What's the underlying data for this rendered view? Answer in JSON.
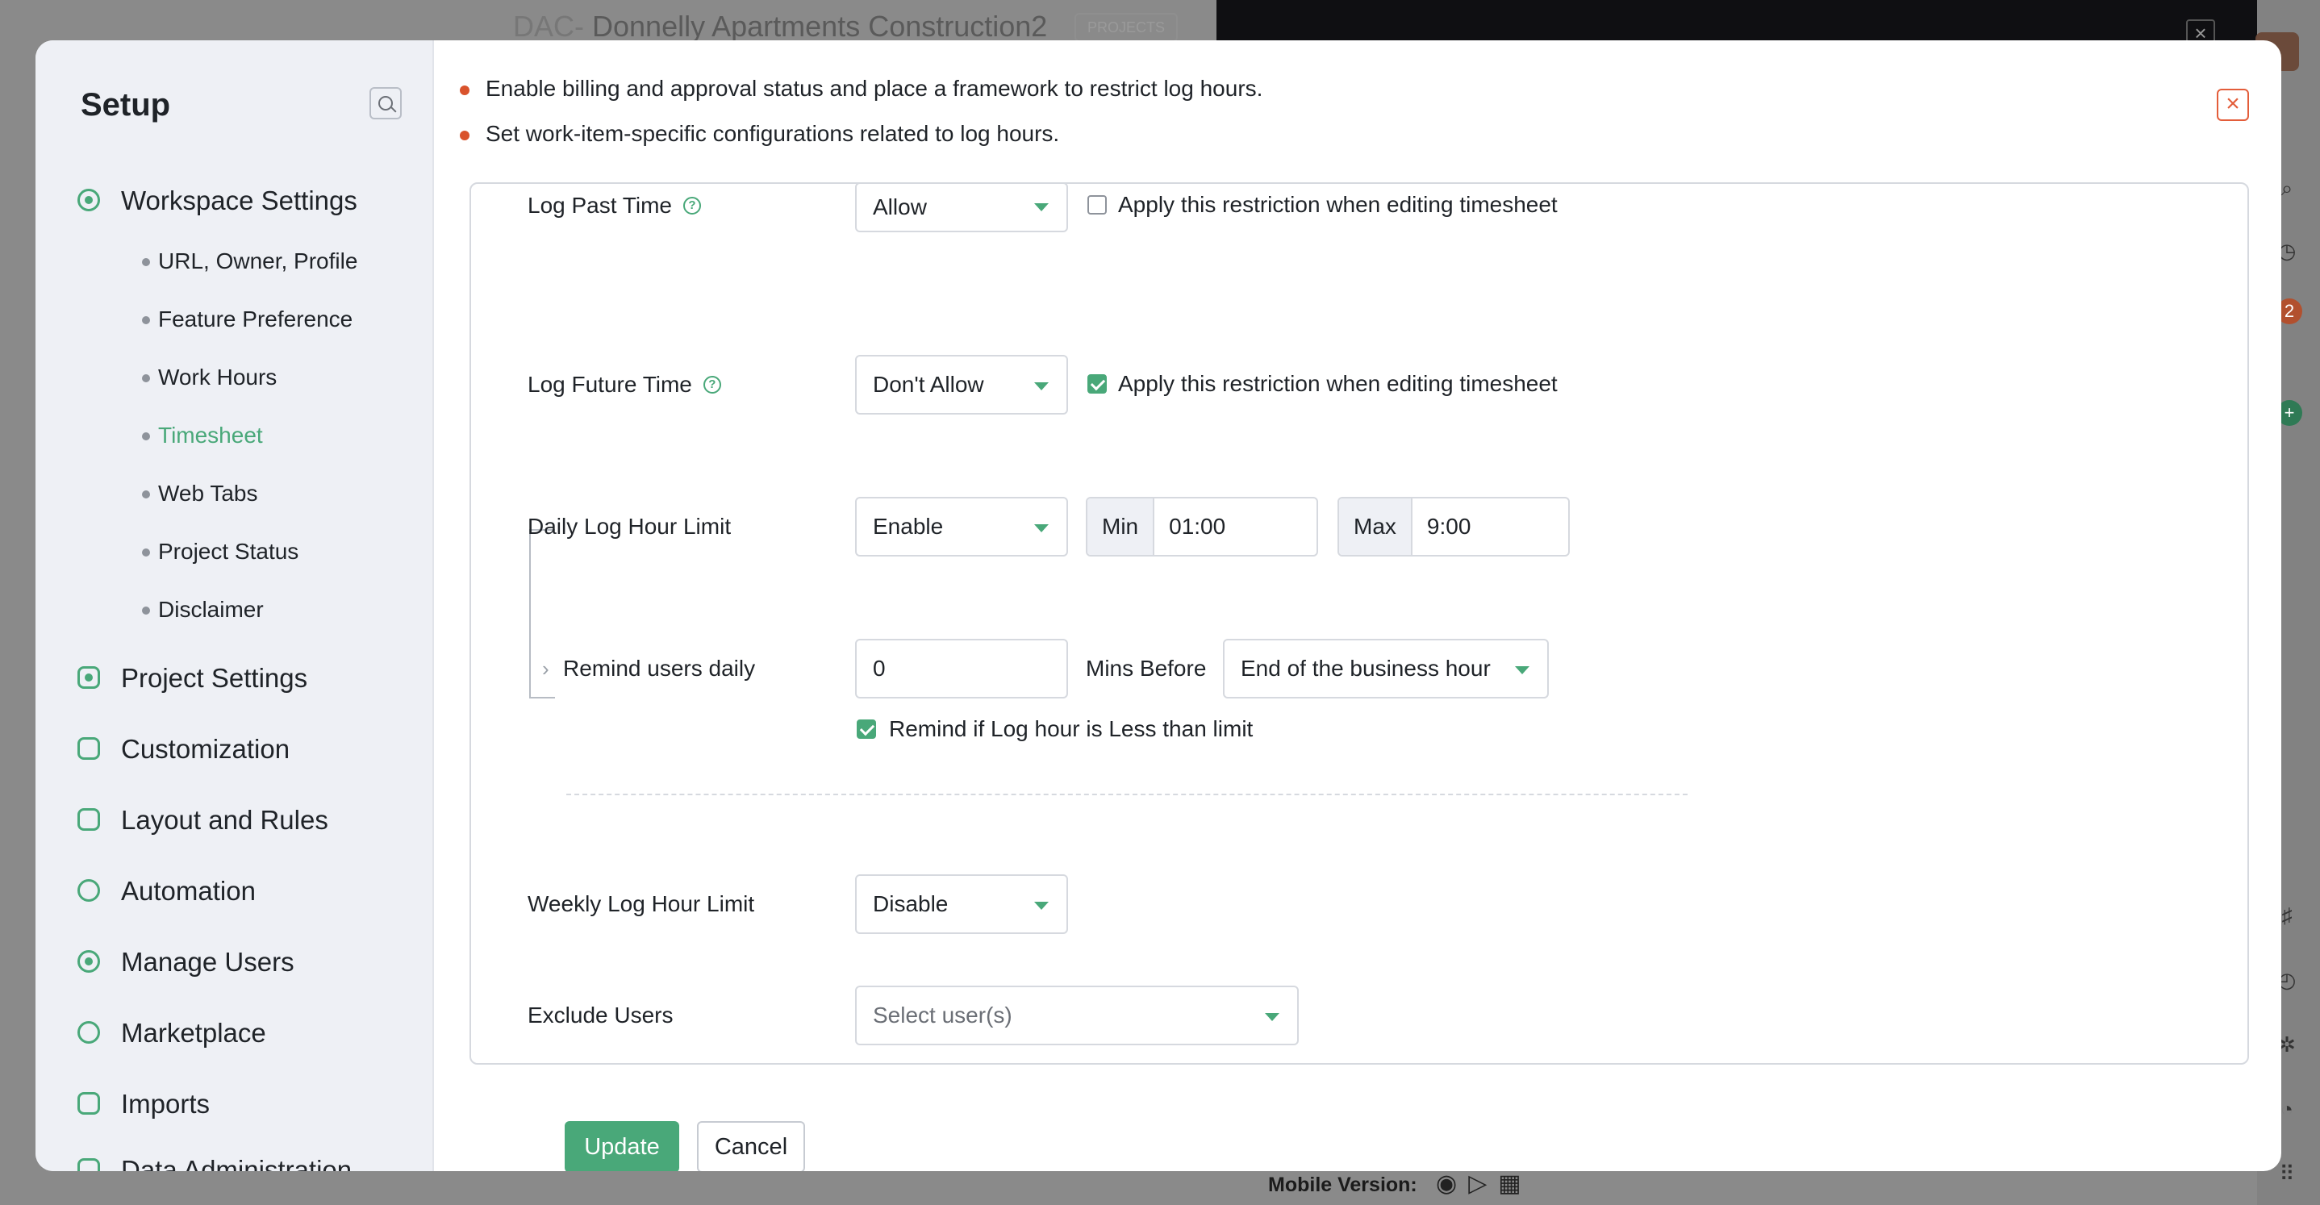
{
  "background": {
    "project_code": "DAC-",
    "project_name": "Donnelly Apartments Construction2",
    "badge": "PROJECTS",
    "notification_count": "2",
    "footer_label": "Mobile Version:"
  },
  "sidebar": {
    "title": "Setup",
    "sections": [
      {
        "label": "Workspace Settings",
        "icon": "workspace-icon"
      },
      {
        "label": "Project Settings",
        "icon": "project-settings-icon"
      },
      {
        "label": "Customization",
        "icon": "customization-icon"
      },
      {
        "label": "Layout and Rules",
        "icon": "layout-rules-icon"
      },
      {
        "label": "Automation",
        "icon": "automation-icon"
      },
      {
        "label": "Manage Users",
        "icon": "manage-users-icon"
      },
      {
        "label": "Marketplace",
        "icon": "marketplace-icon"
      },
      {
        "label": "Imports",
        "icon": "imports-icon"
      },
      {
        "label": "Data Administration",
        "icon": "data-admin-icon"
      }
    ],
    "workspace_items": [
      {
        "label": "URL, Owner, Profile"
      },
      {
        "label": "Feature Preference"
      },
      {
        "label": "Work Hours"
      },
      {
        "label": "Timesheet",
        "active": true
      },
      {
        "label": "Web Tabs"
      },
      {
        "label": "Project Status"
      },
      {
        "label": "Disclaimer"
      }
    ]
  },
  "intro": {
    "bullets": [
      "Enable billing and approval status and place a framework to restrict log hours.",
      "Set work-item-specific configurations related to log hours."
    ]
  },
  "form": {
    "log_past_time": {
      "label": "Log Past Time",
      "value": "Allow",
      "restriction_checked": false,
      "restriction_label": "Apply this restriction when editing timesheet"
    },
    "log_future_time": {
      "label": "Log Future Time",
      "value": "Don't Allow",
      "restriction_checked": true,
      "restriction_label": "Apply this restriction when editing timesheet"
    },
    "daily_limit": {
      "label": "Daily Log Hour Limit",
      "value": "Enable",
      "min_label": "Min",
      "min_value": "01:00",
      "max_label": "Max",
      "max_value": "9:00"
    },
    "remind": {
      "label": "Remind users daily",
      "minutes": "0",
      "mins_before_label": "Mins Before",
      "reference": "End of the business hour",
      "less_than_checked": true,
      "less_than_label": "Remind if Log hour is Less than limit"
    },
    "weekly_limit": {
      "label": "Weekly Log Hour Limit",
      "value": "Disable"
    },
    "exclude_users": {
      "label": "Exclude Users",
      "placeholder": "Select user(s)"
    }
  },
  "actions": {
    "update_label": "Update",
    "cancel_label": "Cancel"
  },
  "colors": {
    "accent": "#49a879",
    "bullet": "#d9532c",
    "close": "#e35d3a"
  }
}
